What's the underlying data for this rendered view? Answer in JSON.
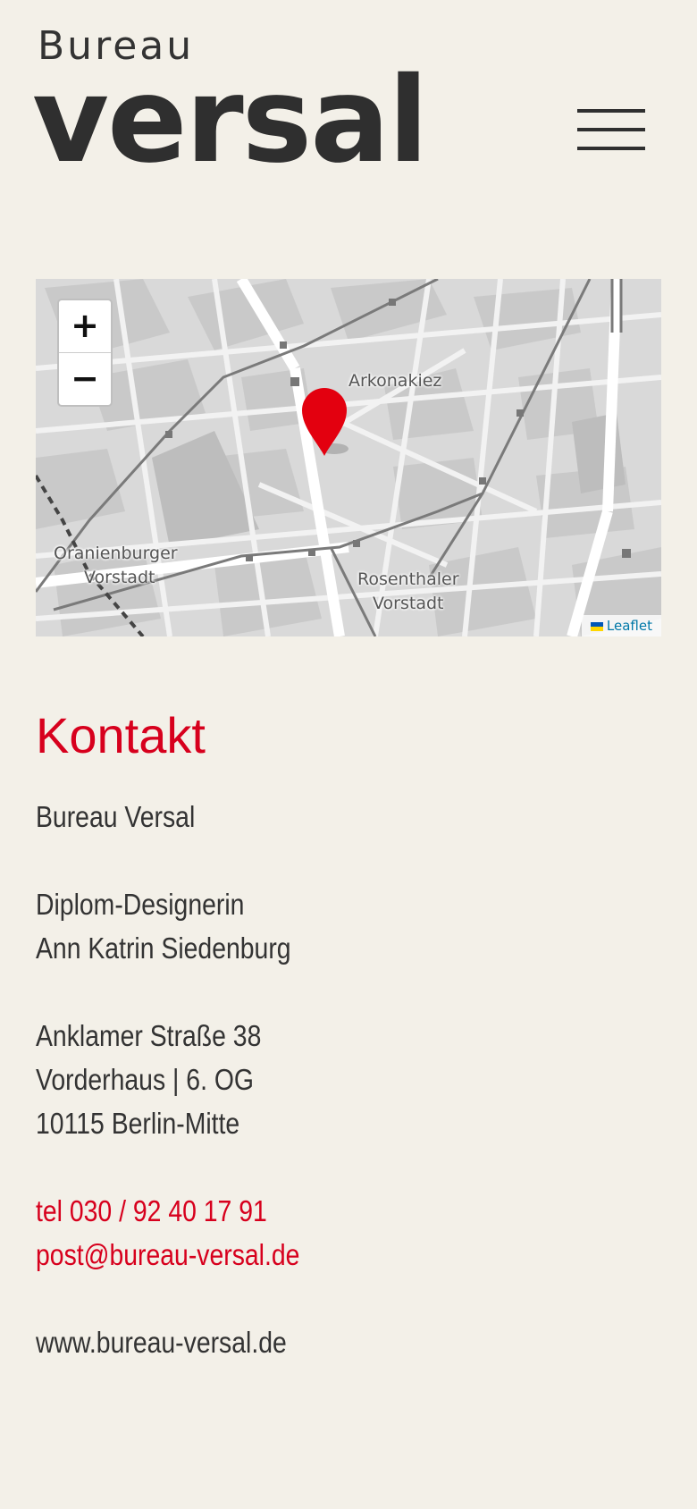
{
  "header": {
    "logo_top": "Bureau",
    "logo_main": "versal",
    "menu_icon": "hamburger-menu-icon"
  },
  "map": {
    "zoom_in": "+",
    "zoom_out": "−",
    "labels": {
      "arkonakiez": "Arkonakiez",
      "oranienburger_1": "Oranienburger",
      "oranienburger_2": "Vorstadt",
      "rosenthaler_1": "Rosenthaler",
      "rosenthaler_2": "Vorstadt"
    },
    "attribution": "Leaflet",
    "marker_color": "#e3000f"
  },
  "contact": {
    "heading": "Kontakt",
    "company": "Bureau Versal",
    "title": "Diplom-Designerin",
    "name": "Ann Katrin Siedenburg",
    "street": "Anklamer Straße 38",
    "building": "Vorderhaus | 6. OG",
    "city": "10115 Berlin-Mitte",
    "phone": "tel 030 / 92 40 17 91",
    "email": "post@bureau-versal.de",
    "website": "www.bureau-versal.de"
  },
  "colors": {
    "accent": "#d7001d",
    "background": "#f3f0e8",
    "text": "#333333"
  }
}
